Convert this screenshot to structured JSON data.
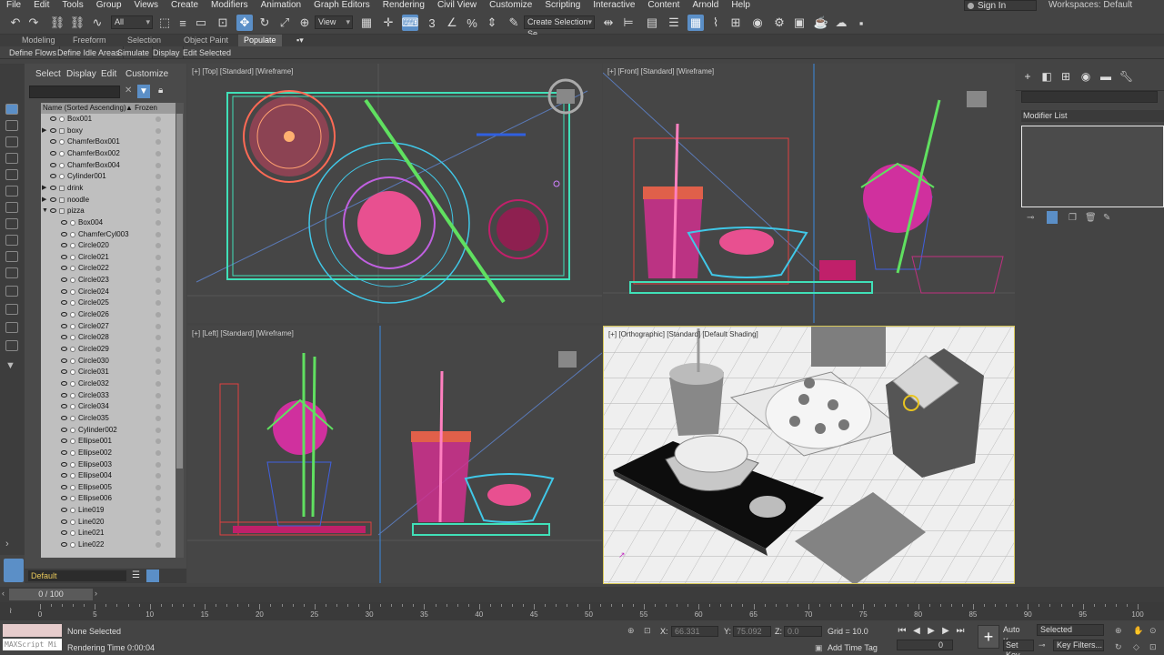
{
  "menu": [
    "File",
    "Edit",
    "Tools",
    "Group",
    "Views",
    "Create",
    "Modifiers",
    "Animation",
    "Graph Editors",
    "Rendering",
    "Civil View",
    "Customize",
    "Scripting",
    "Interactive",
    "Content",
    "Arnold",
    "Help"
  ],
  "signin": "Sign In",
  "workspaces_label": "Workspaces:",
  "workspace": "Default",
  "toolbar": {
    "filter_select": "All",
    "refcoord_select": "View",
    "selection_set": "Create Selection Se"
  },
  "ribbon": {
    "tabs": [
      "Modeling",
      "Freeform",
      "Selection",
      "Object Paint",
      "Populate"
    ],
    "active_tab": "Populate",
    "buttons": [
      "Define Flows",
      "Define Idle Areas",
      "Simulate",
      "Display",
      "Edit Selected"
    ]
  },
  "explorer": {
    "menu": [
      "Select",
      "Display",
      "Edit",
      "Customize"
    ],
    "header_name": "Name (Sorted Ascending)",
    "header_frozen": "▲ Frozen",
    "rows": [
      {
        "name": "Box001",
        "level": 0,
        "group": false
      },
      {
        "name": "boxy",
        "level": 0,
        "group": true
      },
      {
        "name": "ChamferBox001",
        "level": 0,
        "group": false
      },
      {
        "name": "ChamferBox002",
        "level": 0,
        "group": false
      },
      {
        "name": "ChamferBox004",
        "level": 0,
        "group": false
      },
      {
        "name": "Cylinder001",
        "level": 0,
        "group": false
      },
      {
        "name": "drink",
        "level": 0,
        "group": true
      },
      {
        "name": "noodle",
        "level": 0,
        "group": true
      },
      {
        "name": "pizza",
        "level": 0,
        "group": true,
        "open": true
      },
      {
        "name": "Box004",
        "level": 1,
        "group": false
      },
      {
        "name": "ChamferCyl003",
        "level": 1,
        "group": false
      },
      {
        "name": "Circle020",
        "level": 1,
        "group": false
      },
      {
        "name": "Circle021",
        "level": 1,
        "group": false
      },
      {
        "name": "Circle022",
        "level": 1,
        "group": false
      },
      {
        "name": "Circle023",
        "level": 1,
        "group": false
      },
      {
        "name": "Circle024",
        "level": 1,
        "group": false
      },
      {
        "name": "Circle025",
        "level": 1,
        "group": false
      },
      {
        "name": "Circle026",
        "level": 1,
        "group": false
      },
      {
        "name": "Circle027",
        "level": 1,
        "group": false
      },
      {
        "name": "Circle028",
        "level": 1,
        "group": false
      },
      {
        "name": "Circle029",
        "level": 1,
        "group": false
      },
      {
        "name": "Circle030",
        "level": 1,
        "group": false
      },
      {
        "name": "Circle031",
        "level": 1,
        "group": false
      },
      {
        "name": "Circle032",
        "level": 1,
        "group": false
      },
      {
        "name": "Circle033",
        "level": 1,
        "group": false
      },
      {
        "name": "Circle034",
        "level": 1,
        "group": false
      },
      {
        "name": "Circle035",
        "level": 1,
        "group": false
      },
      {
        "name": "Cylinder002",
        "level": 1,
        "group": false
      },
      {
        "name": "Ellipse001",
        "level": 1,
        "group": false
      },
      {
        "name": "Ellipse002",
        "level": 1,
        "group": false
      },
      {
        "name": "Ellipse003",
        "level": 1,
        "group": false
      },
      {
        "name": "Ellipse004",
        "level": 1,
        "group": false
      },
      {
        "name": "Ellipse005",
        "level": 1,
        "group": false
      },
      {
        "name": "Ellipse006",
        "level": 1,
        "group": false
      },
      {
        "name": "Line019",
        "level": 1,
        "group": false
      },
      {
        "name": "Line020",
        "level": 1,
        "group": false
      },
      {
        "name": "Line021",
        "level": 1,
        "group": false
      },
      {
        "name": "Line022",
        "level": 1,
        "group": false
      }
    ]
  },
  "viewports": {
    "top": "[+] [Top] [Standard] [Wireframe]",
    "front": "[+] [Front] [Standard] [Wireframe]",
    "left": "[+] [Left] [Standard] [Wireframe]",
    "persp": "[+] [Orthographic] [Standard] [Default Shading]"
  },
  "command_panel": {
    "modifier_list": "Modifier List"
  },
  "layer": "Default",
  "time": {
    "slider": "0 / 100",
    "ticks": [
      0,
      5,
      10,
      15,
      20,
      25,
      30,
      35,
      40,
      45,
      50,
      55,
      60,
      65,
      70,
      75,
      80,
      85,
      90,
      95,
      100
    ]
  },
  "status": {
    "selection": "None Selected",
    "render_time": "Rendering Time  0:00:04",
    "maxscript": "MAXScript Mi",
    "x_label": "X:",
    "x": "66.331",
    "y_label": "Y:",
    "y": "75.092",
    "z_label": "Z:",
    "z": "0.0",
    "grid": "Grid = 10.0",
    "add_time_tag": "Add Time Tag",
    "frame": "0",
    "auto_key": "Auto Key",
    "key_mode": "Selected",
    "set_key": "Set Key",
    "key_filters": "Key Filters..."
  },
  "colors": {
    "accent": "#5b8fc7",
    "viewport_bg": "#464646",
    "selected_border": "#d8c85a"
  }
}
